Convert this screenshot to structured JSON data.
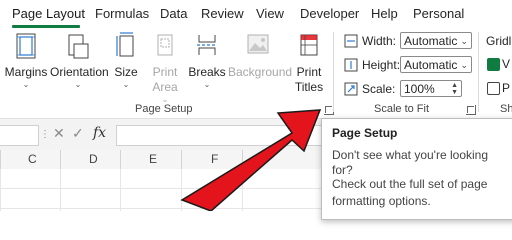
{
  "tabs": [
    "Page Layout",
    "Formulas",
    "Data",
    "Review",
    "View",
    "Developer",
    "Help",
    "Personal"
  ],
  "active_tab": "Page Layout",
  "ribbon": {
    "page_setup": {
      "buttons": {
        "margins": "Margins",
        "orientation": "Orientation",
        "size": "Size",
        "print_area_1": "Print",
        "print_area_2": "Area",
        "breaks": "Breaks",
        "background": "Background",
        "print_titles_1": "Print",
        "print_titles_2": "Titles"
      },
      "label": "Page Setup"
    },
    "scale_to_fit": {
      "width_label": "Width:",
      "width_value": "Automatic",
      "height_label": "Height:",
      "height_value": "Automatic",
      "scale_label": "Scale:",
      "scale_value": "100%",
      "label": "Scale to Fit"
    },
    "sheet_options": {
      "gridlines_label": "Gridli",
      "view_initial": "V",
      "print_initial": "P",
      "label": "Sh"
    }
  },
  "formula_bar": {
    "cancel": "✕",
    "enter": "✓",
    "fx": "fx"
  },
  "columns": [
    "C",
    "D",
    "E",
    "F"
  ],
  "tooltip": {
    "title": "Page Setup",
    "line1": "Don't see what you're looking for?",
    "line2": "Check out the full set of page",
    "line3": "formatting options."
  },
  "colors": {
    "accent": "#107c41",
    "arrow": "#e3141b"
  },
  "icons": [
    "margins-icon",
    "orientation-icon",
    "size-icon",
    "print-area-icon",
    "breaks-icon",
    "background-icon",
    "print-titles-icon",
    "width-icon",
    "height-icon",
    "scale-icon",
    "dialog-launcher-icon"
  ]
}
